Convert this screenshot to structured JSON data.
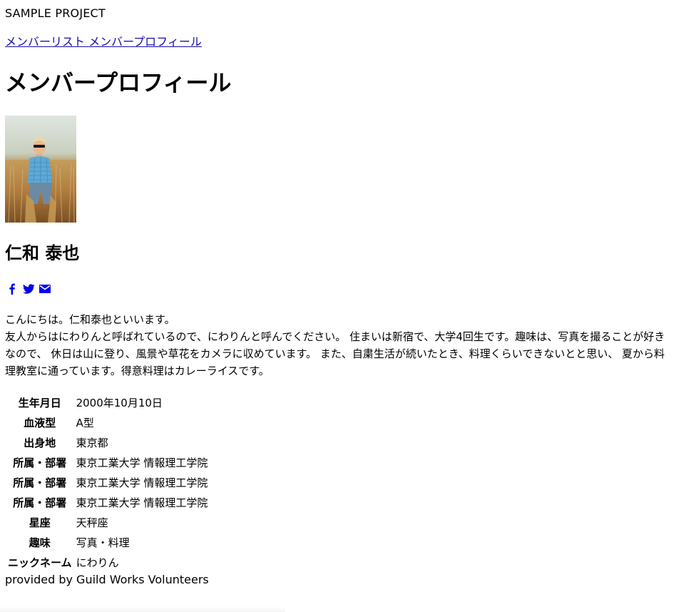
{
  "header": {
    "site_title": "SAMPLE PROJECT"
  },
  "breadcrumb": {
    "items": [
      {
        "label": "メンバーリスト"
      },
      {
        "label": "メンバープロフィール"
      }
    ]
  },
  "page": {
    "title": "メンバープロフィール"
  },
  "profile": {
    "name": "仁和 泰也",
    "social": [
      {
        "icon": "facebook-icon",
        "color": "#0000ee"
      },
      {
        "icon": "twitter-icon",
        "color": "#0000ee"
      },
      {
        "icon": "mail-icon",
        "color": "#0000ee"
      }
    ],
    "intro_lines": [
      "こんにちは。仁和泰也といいます。",
      "友人からはにわりんと呼ばれているので、にわりんと呼んでください。 住まいは新宿で、大学4回生です。趣味は、写真を撮ることが好きなので、 休日は山に登り、風景や草花をカメラに収めています。 また、自粛生活が続いたとき、料理くらいできないとと思い、 夏から料理教室に通っています。得意料理はカレーライスです。"
    ],
    "details": [
      {
        "label": "生年月日",
        "value": "2000年10月10日"
      },
      {
        "label": "血液型",
        "value": "A型"
      },
      {
        "label": "出身地",
        "value": "東京都"
      },
      {
        "label": "所属・部署",
        "value": "東京工業大学 情報理工学院"
      },
      {
        "label": "所属・部署",
        "value": "東京工業大学 情報理工学院"
      },
      {
        "label": "所属・部署",
        "value": "東京工業大学 情報理工学院"
      },
      {
        "label": "星座",
        "value": "天秤座"
      },
      {
        "label": "趣味",
        "value": "写真・料理"
      },
      {
        "label": "ニックネーム",
        "value": "にわりん"
      }
    ]
  },
  "footer": {
    "text": "provided by Guild Works Volunteers"
  }
}
